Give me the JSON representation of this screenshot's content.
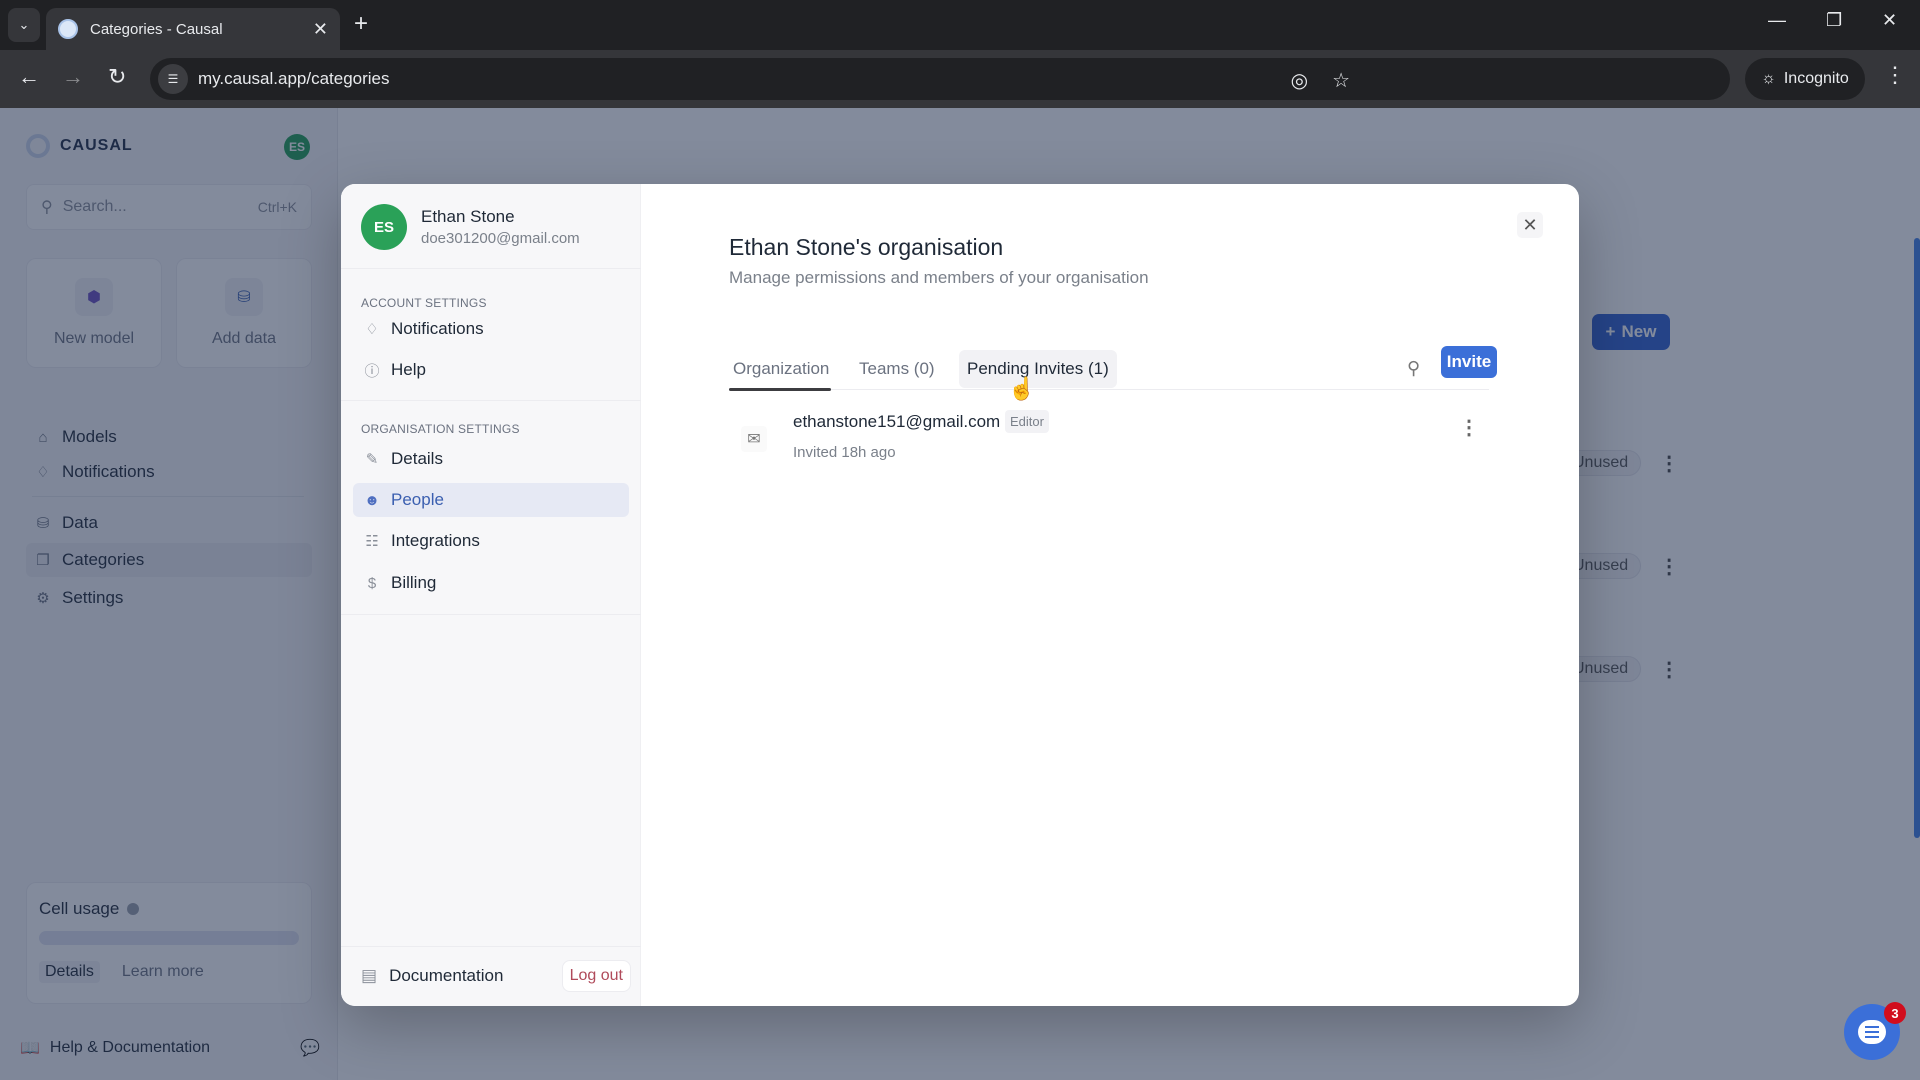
{
  "browser": {
    "tab_title": "Categories - Causal",
    "url": "my.causal.app/categories",
    "incognito_label": "Incognito"
  },
  "sidebar": {
    "brand": "CAUSAL",
    "avatar_initials": "ES",
    "search_placeholder": "Search...",
    "search_shortcut": "Ctrl+K",
    "cards": [
      {
        "label": "New model",
        "icon": "cube-icon"
      },
      {
        "label": "Add data",
        "icon": "database-icon"
      }
    ],
    "nav": [
      {
        "label": "Models",
        "icon": "home-icon"
      },
      {
        "label": "Notifications",
        "icon": "bell-icon"
      },
      {
        "label": "Data",
        "icon": "database-icon"
      },
      {
        "label": "Categories",
        "icon": "categories-icon",
        "active": true
      },
      {
        "label": "Settings",
        "icon": "gear-icon"
      }
    ],
    "usage": {
      "title": "Cell usage",
      "details_label": "Details",
      "learn_more_label": "Learn more"
    },
    "help_label": "Help & Documentation"
  },
  "background": {
    "new_button": "New",
    "row_status": [
      "Unused",
      "Unused",
      "Unused"
    ]
  },
  "modal": {
    "user": {
      "initials": "ES",
      "name": "Ethan Stone",
      "email": "doe301200@gmail.com"
    },
    "account_section": "ACCOUNT SETTINGS",
    "account_items": [
      {
        "label": "Notifications",
        "icon": "bell-icon"
      },
      {
        "label": "Help",
        "icon": "help-icon"
      }
    ],
    "org_section": "ORGANISATION SETTINGS",
    "org_items": [
      {
        "label": "Details",
        "icon": "pencil-icon"
      },
      {
        "label": "People",
        "icon": "people-icon",
        "active": true
      },
      {
        "label": "Integrations",
        "icon": "integrations-icon"
      },
      {
        "label": "Billing",
        "icon": "dollar-icon"
      }
    ],
    "documentation_label": "Documentation",
    "logout_label": "Log out",
    "title": "Ethan Stone's organisation",
    "subtitle": "Manage permissions and members of your organisation",
    "tabs": [
      {
        "label": "Organization",
        "active": true
      },
      {
        "label": "Teams (0)"
      },
      {
        "label": "Pending Invites (1)",
        "hover": true
      }
    ],
    "invite_label": "Invite",
    "invites": [
      {
        "email": "ethanstone151@gmail.com",
        "role": "Editor",
        "invited": "Invited 18h ago"
      }
    ]
  },
  "chat_widget": {
    "badge_count": "3"
  },
  "colors": {
    "accent": "#3b6fd8",
    "avatar": "#2aa158",
    "badge": "#d10d1d"
  }
}
